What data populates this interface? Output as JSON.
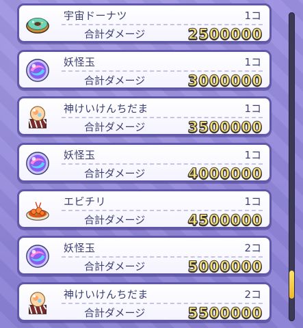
{
  "damage_label": "合計ダメージ",
  "items": [
    {
      "name": "宇宙ドーナツ",
      "count": "1コ",
      "damage": "2500000",
      "icon": "space-donut-icon"
    },
    {
      "name": "妖怪玉",
      "count": "1コ",
      "damage": "3000000",
      "icon": "yokai-orb-icon"
    },
    {
      "name": "神けいけんちだま",
      "count": "1コ",
      "damage": "3500000",
      "icon": "divine-exp-orb-icon"
    },
    {
      "name": "妖怪玉",
      "count": "1コ",
      "damage": "4000000",
      "icon": "yokai-orb-icon"
    },
    {
      "name": "エビチリ",
      "count": "1コ",
      "damage": "4500000",
      "icon": "shrimp-chili-icon"
    },
    {
      "name": "妖怪玉",
      "count": "2コ",
      "damage": "5000000",
      "icon": "yokai-orb-icon"
    },
    {
      "name": "神けいけんちだま",
      "count": "2コ",
      "damage": "5500000",
      "icon": "divine-exp-orb-icon"
    }
  ],
  "colors": {
    "background": "#8f84d6",
    "row_border": "#5f57a8",
    "damage_number": "#f7e27a",
    "scroll_thumb": "#f1b92a"
  },
  "scrollbar": {
    "position_fraction": 0.92,
    "visible_fraction": 0.09
  }
}
